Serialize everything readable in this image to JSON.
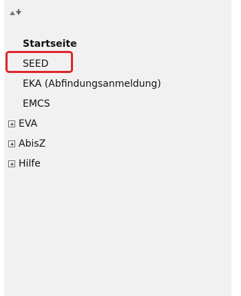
{
  "sort_controls": {
    "up_icon": "sort-up-triangle",
    "down_icon": "sort-down-arrow"
  },
  "navigation": {
    "items": [
      {
        "label": "Startseite",
        "type": "leaf",
        "bold": true
      },
      {
        "label": "SEED",
        "type": "leaf",
        "highlighted": true
      },
      {
        "label": "EKA (Abfindungsanmeldung)",
        "type": "leaf"
      },
      {
        "label": "EMCS",
        "type": "leaf"
      },
      {
        "label": "EVA",
        "type": "folder",
        "icon": "expand-plus-icon"
      },
      {
        "label": "AbisZ",
        "type": "folder",
        "icon": "expand-plus-icon"
      },
      {
        "label": "Hilfe",
        "type": "folder",
        "icon": "expand-plus-icon"
      }
    ]
  },
  "colors": {
    "panel_background": "#f1f1f1",
    "text": "#111111",
    "highlight_border": "#e0232b",
    "icon_gray": "#6f6f6f"
  }
}
